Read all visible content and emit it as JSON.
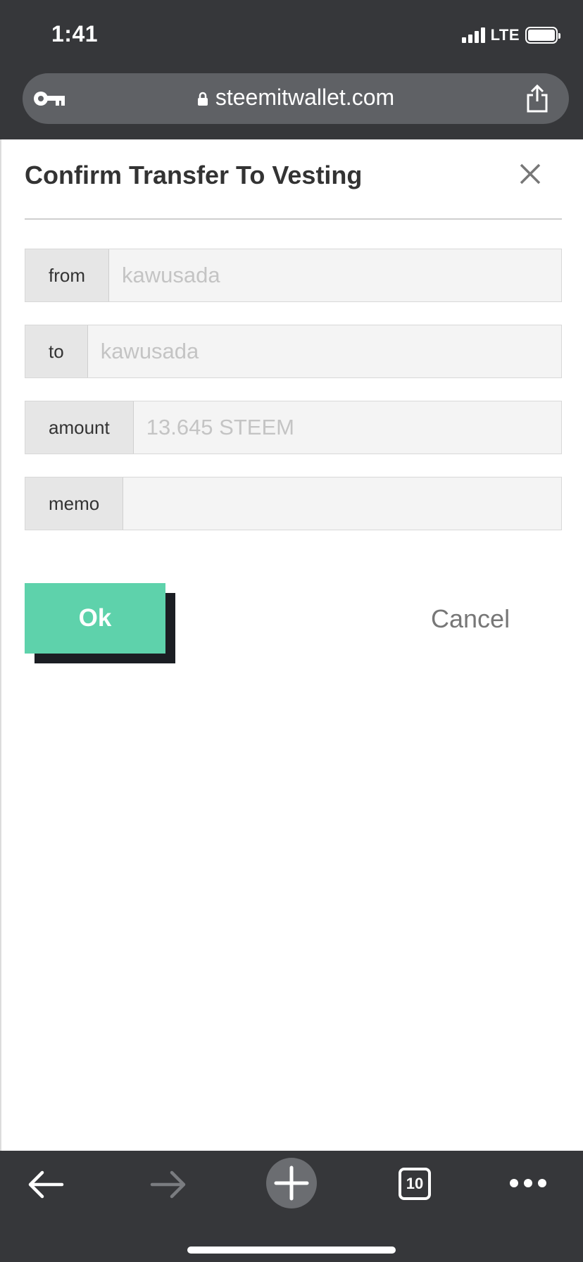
{
  "status_bar": {
    "time": "1:41",
    "network": "LTE"
  },
  "browser": {
    "url": "steemitwallet.com"
  },
  "modal": {
    "title": "Confirm Transfer To Vesting",
    "fields": [
      {
        "label": "from",
        "value": "kawusada"
      },
      {
        "label": "to",
        "value": "kawusada"
      },
      {
        "label": "amount",
        "value": "13.645 STEEM"
      },
      {
        "label": "memo",
        "value": ""
      }
    ],
    "ok_label": "Ok",
    "cancel_label": "Cancel"
  },
  "toolbar": {
    "tabs_count": "10"
  },
  "colors": {
    "accent": "#5ed2ab",
    "chrome": "#36373a"
  }
}
